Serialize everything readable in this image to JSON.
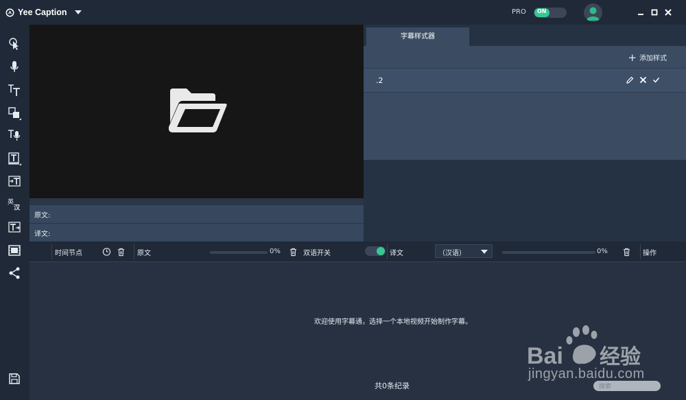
{
  "app": {
    "title": "Yee Caption",
    "pro_label": "PRO",
    "pro_toggle_label": "ON"
  },
  "video": {
    "source_label": "原文:",
    "translation_label": "译文:"
  },
  "style_panel": {
    "tab_label": "字幕样式器",
    "add_label": "添加样式",
    "items": [
      {
        "name": ".2"
      }
    ]
  },
  "subtitle_table": {
    "col_time": "时间节点",
    "col_source": "原文",
    "source_progress": "0%",
    "source_progress_value": 0,
    "bilingual_label": "双语开关",
    "col_translation": "译文",
    "language": "（汉语）",
    "translation_progress": "0%",
    "translation_progress_value": 0,
    "col_actions": "操作",
    "welcome": "欢迎使用字幕通，选择一个本地视频开始制作字幕。",
    "record_count": "共0条纪录"
  },
  "watermark": {
    "text": "jingyan.baidu.com",
    "search_placeholder": "搜索"
  },
  "icons": {
    "toolbar": [
      "cursor-icon",
      "microphone-icon",
      "text-size-icon",
      "shape-icon",
      "text-voice-icon",
      "text-box-icon",
      "text-import-icon",
      "translate-icon",
      "text-export-icon",
      "film-icon",
      "share-icon",
      "save-icon"
    ]
  },
  "colors": {
    "accent": "#36c794",
    "titlebar": "#1f2937",
    "panel": "#3a4b62"
  }
}
